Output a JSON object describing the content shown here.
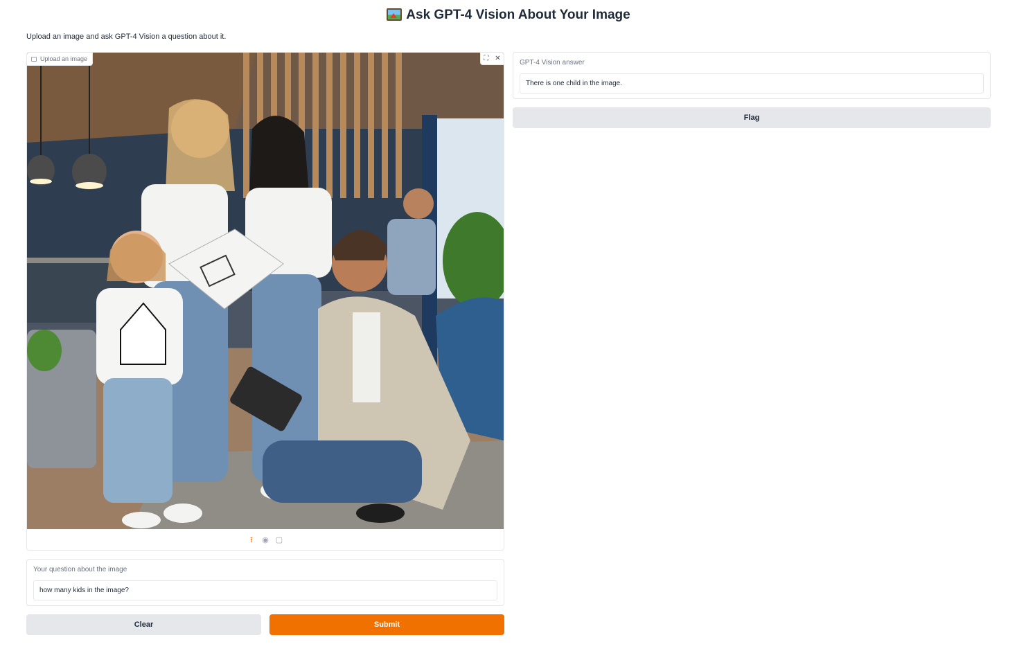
{
  "header": {
    "icon": "framed-picture-icon",
    "title": "Ask GPT-4 Vision About Your Image",
    "subtitle": "Upload an image and ask GPT-4 Vision a question about it."
  },
  "image_input": {
    "label": "Upload an image",
    "tool_icons": [
      "fullscreen-icon",
      "close-icon"
    ],
    "source_icons": [
      "upload-icon",
      "webcam-icon",
      "clipboard-icon"
    ]
  },
  "question": {
    "label": "Your question about the image",
    "value": "how many kids in the image?"
  },
  "buttons": {
    "clear": "Clear",
    "submit": "Submit",
    "flag": "Flag"
  },
  "answer": {
    "label": "GPT-4 Vision answer",
    "value": "There is one child in the image."
  },
  "colors": {
    "primary": "#f07000",
    "secondary_button": "#e5e7eb"
  }
}
